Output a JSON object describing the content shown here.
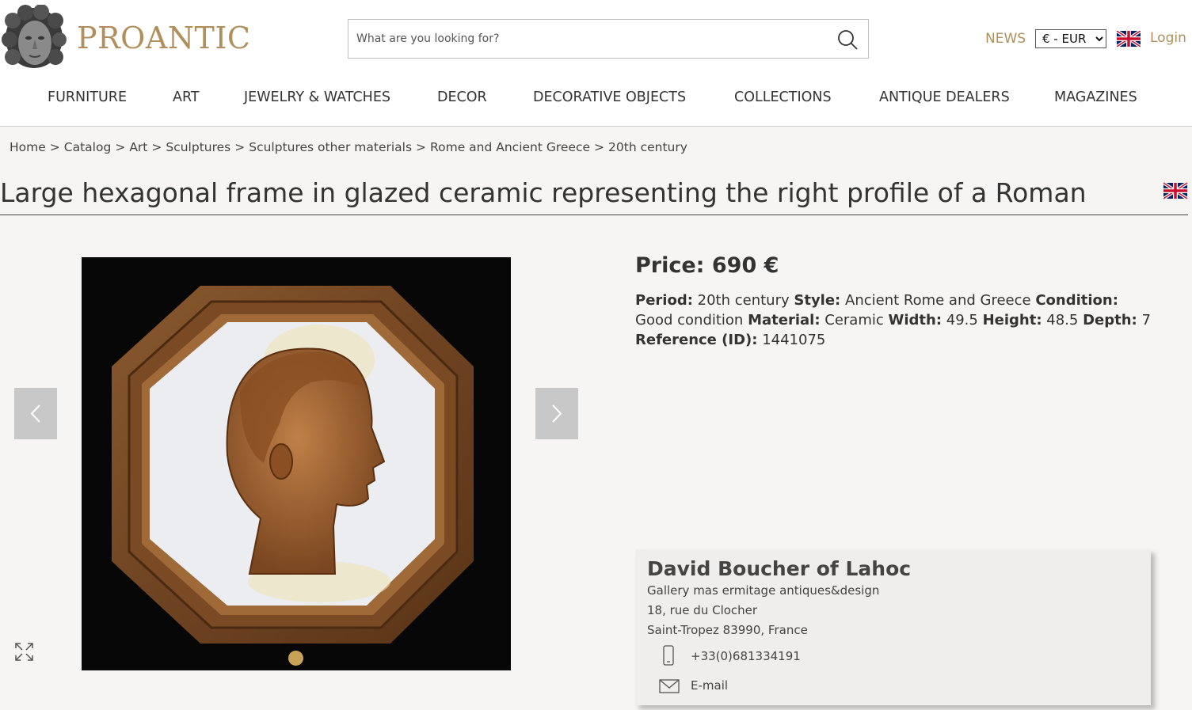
{
  "header": {
    "logo_text": "PROANTIC",
    "search_placeholder": "What are you looking for?",
    "news_label": "NEWS",
    "currency_selected": "€ - EUR",
    "login_label": "Login"
  },
  "nav": {
    "items": [
      "FURNITURE",
      "ART",
      "JEWELRY & WATCHES",
      "DECOR",
      "DECORATIVE OBJECTS",
      "COLLECTIONS",
      "ANTIQUE DEALERS",
      "MAGAZINES"
    ]
  },
  "breadcrumb": [
    "Home",
    "Catalog",
    "Art",
    "Sculptures",
    "Sculptures other materials",
    "Rome and Ancient Greece",
    "20th century"
  ],
  "breadcrumb_separator": ">",
  "product": {
    "title": "Large hexagonal frame in glazed ceramic representing the right profile of a Roman",
    "price_label": "Price:",
    "price_value": "690 €",
    "specs": [
      {
        "label": "Period:",
        "value": "20th century"
      },
      {
        "label": "Style:",
        "value": "Ancient Rome and Greece"
      },
      {
        "label": "Condition:",
        "value": "Good condition"
      },
      {
        "label": "Material:",
        "value": "Ceramic"
      },
      {
        "label": "Width:",
        "value": "49.5"
      },
      {
        "label": "Height:",
        "value": "48.5"
      },
      {
        "label": "Depth:",
        "value": "7"
      },
      {
        "label": "Reference (ID):",
        "value": "1441075"
      }
    ]
  },
  "dealer": {
    "name": "David Boucher of Lahoc",
    "gallery": "Gallery mas ermitage antiques&design",
    "street": "18, rue du Clocher",
    "city": "Saint-Tropez 83990, France",
    "phone": "+33(0)681334191",
    "email_label": "E-mail"
  },
  "colors": {
    "accent": "#b08f5c",
    "carousel_dot": "#c9a355",
    "page_bg": "#f6f5f3"
  }
}
